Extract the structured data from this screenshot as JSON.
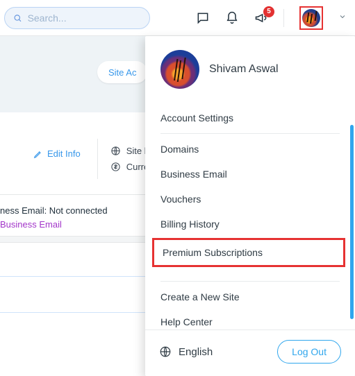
{
  "topbar": {
    "search_placeholder": "Search...",
    "notification_count": "5"
  },
  "hero": {
    "button_label": "Site Ac"
  },
  "mid": {
    "edit_info": "Edit Info",
    "site_row": "Site la",
    "currency_row": "Curre"
  },
  "status": {
    "line1": "ness Email: Not connected",
    "link": "Business Email"
  },
  "user": {
    "name": "Shivam Aswal"
  },
  "menu": {
    "account_settings": "Account Settings",
    "domains": "Domains",
    "business_email": "Business Email",
    "vouchers": "Vouchers",
    "billing_history": "Billing History",
    "premium_subscriptions": "Premium Subscriptions",
    "create_site": "Create a New Site",
    "help_center": "Help Center"
  },
  "footer": {
    "language": "English",
    "logout": "Log Out"
  }
}
